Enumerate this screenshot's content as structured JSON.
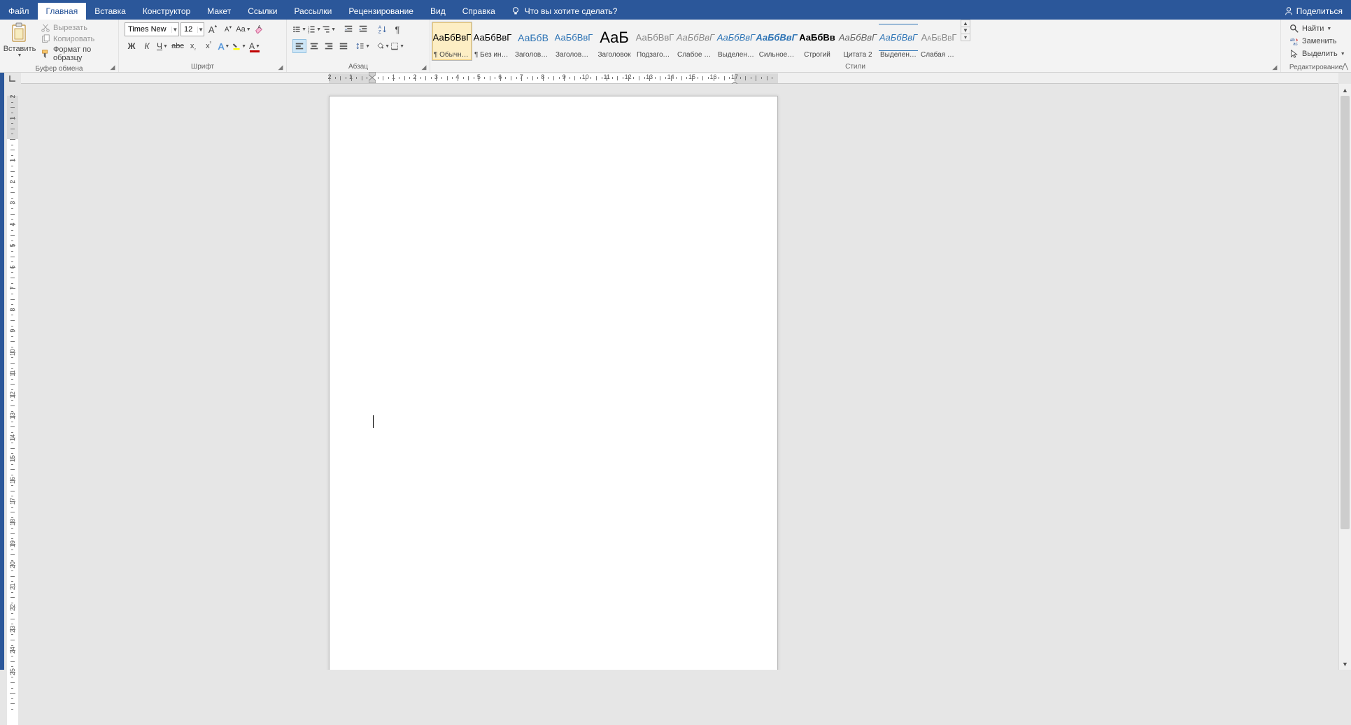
{
  "tabs": {
    "file": "Файл",
    "home": "Главная",
    "insert": "Вставка",
    "design": "Конструктор",
    "layout": "Макет",
    "references": "Ссылки",
    "mailings": "Рассылки",
    "review": "Рецензирование",
    "view": "Вид",
    "help": "Справка",
    "tell_me": "Что вы хотите сделать?",
    "share": "Поделиться"
  },
  "clipboard": {
    "paste": "Вставить",
    "cut": "Вырезать",
    "copy": "Копировать",
    "format_painter": "Формат по образцу",
    "group": "Буфер обмена"
  },
  "font": {
    "name": "Times New Rom",
    "size": "12",
    "group": "Шрифт"
  },
  "paragraph": {
    "group": "Абзац"
  },
  "styles": {
    "group": "Стили",
    "items": [
      {
        "preview": "АаБбВвГ",
        "label": "¶ Обычный",
        "cls": "normal"
      },
      {
        "preview": "АаБбВвГ",
        "label": "¶ Без инте…",
        "cls": "nospacing"
      },
      {
        "preview": "АаБбВ",
        "label": "Заголово…",
        "cls": "h1"
      },
      {
        "preview": "АаБбВвГ",
        "label": "Заголово…",
        "cls": "h2"
      },
      {
        "preview": "АаБ",
        "label": "Заголовок",
        "cls": "title"
      },
      {
        "preview": "АаБбВвГ",
        "label": "Подзагол…",
        "cls": "subtitle"
      },
      {
        "preview": "АаБбВвГ",
        "label": "Слабое в…",
        "cls": "subtle-emph"
      },
      {
        "preview": "АаБбВвГ",
        "label": "Выделение",
        "cls": "emph"
      },
      {
        "preview": "АаБбВвГ",
        "label": "Сильное…",
        "cls": "intense-emph"
      },
      {
        "preview": "АаБбВв",
        "label": "Строгий",
        "cls": "strong"
      },
      {
        "preview": "АаБбВвГ",
        "label": "Цитата 2",
        "cls": "quote"
      },
      {
        "preview": "АаБбВвГ",
        "label": "Выделенн…",
        "cls": "intense-quote"
      },
      {
        "preview": "АаБбВвГ",
        "label": "Слабая сс…",
        "cls": "subtle-ref"
      }
    ]
  },
  "editing": {
    "find": "Найти",
    "replace": "Заменить",
    "select": "Выделить",
    "group": "Редактирование"
  },
  "ruler": {
    "h_numbers": [
      "2",
      "1",
      "1",
      "2",
      "3",
      "4",
      "5",
      "6",
      "7",
      "8",
      "9",
      "10",
      "11",
      "12",
      "13",
      "14",
      "15",
      "16",
      "17"
    ],
    "v_numbers": [
      "2",
      "1",
      "1",
      "2",
      "3",
      "4",
      "5",
      "6",
      "7",
      "8",
      "9",
      "10",
      "11",
      "12",
      "13",
      "14",
      "15",
      "16",
      "17",
      "18",
      "19",
      "20"
    ]
  }
}
